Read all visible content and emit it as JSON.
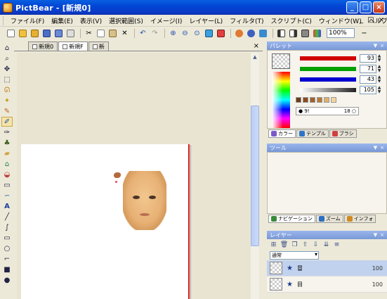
{
  "window": {
    "title": "PictBear - [新規0]",
    "buttons": [
      "_",
      "□",
      "×"
    ]
  },
  "menu": {
    "items": [
      "ファイル(F)",
      "編集(E)",
      "表示(V)",
      "選択範囲(S)",
      "イメージ(I)",
      "レイヤー(L)",
      "フィルタ(T)",
      "スクリプト(C)",
      "ウィンドウ(W)",
      "ヘルプ(H)"
    ],
    "mdi_buttons": [
      "_",
      "□",
      "×"
    ]
  },
  "toolbar": {
    "zoom": "100%"
  },
  "document": {
    "tabs": [
      {
        "label": "新規0",
        "active": false
      },
      {
        "label": "新規F",
        "active": true
      },
      {
        "label": "新",
        "active": false
      }
    ],
    "close": "×"
  },
  "palette_panel": {
    "title": "パレット",
    "rgb": [
      {
        "color": "#d00000",
        "value": "93"
      },
      {
        "color": "#00a000",
        "value": "71"
      },
      {
        "color": "#0000d0",
        "value": "43"
      },
      {
        "color": "#222222",
        "value": "105"
      }
    ],
    "swatches": [
      "#6b3b1a",
      "#8a4a1e",
      "#a0602a",
      "#b77838",
      "#e0b070",
      "#f4d49c"
    ],
    "toggle_left": "● 9!",
    "toggle_right": "18 ○",
    "tabs": [
      {
        "label": "カラー",
        "color": "#7a5acb"
      },
      {
        "label": "テンプル",
        "color": "#2c74c9"
      },
      {
        "label": "ブラシ",
        "color": "#d04040"
      }
    ]
  },
  "navigator_panel": {
    "title": "ツール",
    "tabs": [
      {
        "label": "ナビゲーション",
        "color": "#3a8a3a"
      },
      {
        "label": "ズーム",
        "color": "#2a6fc0"
      },
      {
        "label": "インフォ",
        "color": "#d08a20"
      }
    ]
  },
  "layers_panel": {
    "title": "レイヤー",
    "blend_mode": "通常",
    "layers": [
      {
        "name": "冒",
        "opacity": "100",
        "selected": true
      },
      {
        "name": "目",
        "opacity": "100",
        "selected": false
      }
    ]
  }
}
